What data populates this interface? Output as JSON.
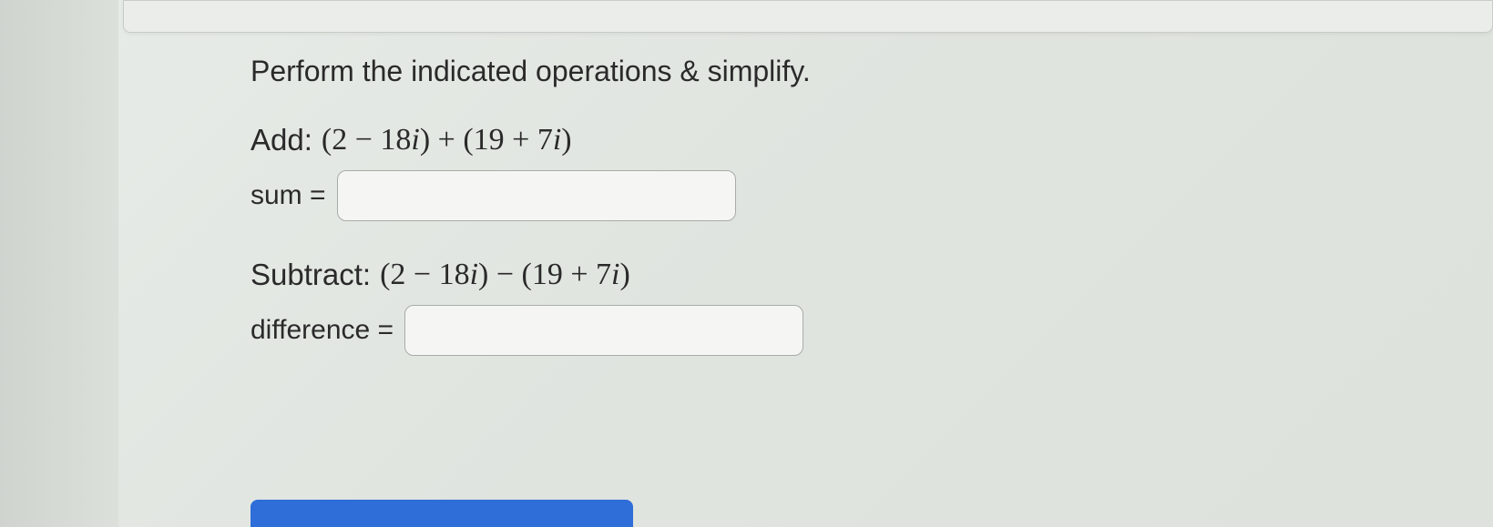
{
  "instruction": "Perform the indicated operations & simplify.",
  "problems": {
    "add": {
      "label": "Add:",
      "expression": "(2 − 18i) + (19 + 7i)",
      "answer_label": "sum =",
      "value": ""
    },
    "subtract": {
      "label": "Subtract:",
      "expression": "(2 − 18i) − (19 + 7i)",
      "answer_label": "difference =",
      "value": ""
    }
  }
}
